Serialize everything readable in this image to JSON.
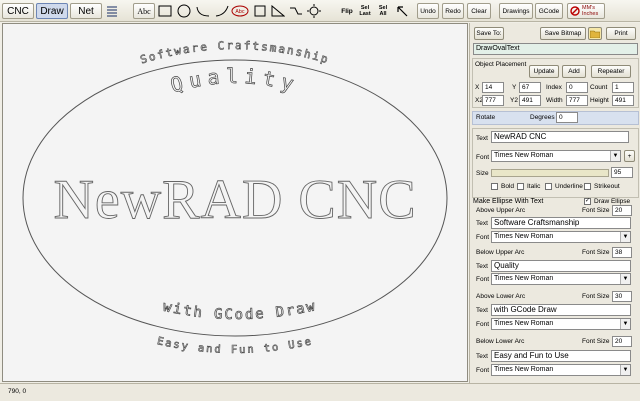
{
  "toolbar": {
    "tabs": [
      "CNC",
      "Draw",
      "Net"
    ],
    "text_tool": "Abc",
    "flip_label": "Flip",
    "sel_last_label": "Sel Last",
    "sel_all_label": "Sel All",
    "undo_label": "Undo",
    "redo_label": "Redo",
    "clear_label": "Clear",
    "drawings_label": "Drawings",
    "gcode_label": "GCode",
    "units_mm": "MM's",
    "units_inches": "Inches"
  },
  "panel": {
    "save_to_label": "Save To:",
    "save_bitmap_label": "Save Bitmap",
    "print_label": "Print",
    "current_object": "DrawOvalText",
    "object_placement": {
      "title": "Object Placement",
      "update_label": "Update",
      "add_label": "Add",
      "repeater_label": "Repeater",
      "x_label": "X",
      "x_value": "14",
      "y_label": "Y",
      "y_value": "67",
      "index_label": "Index",
      "index_value": "0",
      "count_label": "Count",
      "count_value": "1",
      "x2_label": "X2",
      "x2_value": "777",
      "y2_label": "Y2",
      "y2_value": "491",
      "width_label": "Width",
      "width_value": "777",
      "height_label": "Height",
      "height_value": "491"
    },
    "rotate": {
      "label": "Rotate",
      "degrees_label": "Degrees",
      "degrees_value": "0"
    },
    "text_section": {
      "text_label": "Text",
      "text_value": "NewRAD CNC",
      "font_label": "Font",
      "font_value": "Times New Roman",
      "size_label": "Size",
      "size_value": "95",
      "bold_label": "Bold",
      "italic_label": "Italic",
      "underline_label": "Underline",
      "strikeout_label": "Strikeout",
      "plus_label": "+"
    },
    "ellipse": {
      "title": "Make Ellipse With Text",
      "draw_ellipse_label": "Draw Ellipse",
      "font_size_label": "Font Size",
      "text_label": "Text",
      "font_label": "Font",
      "arcs": [
        {
          "heading": "Above Upper Arc",
          "font_size": "20",
          "text": "Software Craftsmanship",
          "font": "Times New Roman"
        },
        {
          "heading": "Below Upper Arc",
          "font_size": "38",
          "text": "Quality",
          "font": "Times New Roman"
        },
        {
          "heading": "Above Lower Arc",
          "font_size": "30",
          "text": "with GCode Draw",
          "font": "Times New Roman"
        },
        {
          "heading": "Below Lower Arc",
          "font_size": "20",
          "text": "Easy and Fun to Use",
          "font": "Times New Roman"
        }
      ]
    }
  },
  "canvas": {
    "center_text": "NewRAD CNC",
    "upper_outer": "Software Craftsmanship",
    "upper_inner": "Quality",
    "lower_inner": "with GCode Draw",
    "lower_outer": "Easy and Fun to Use"
  },
  "status": {
    "coords": "790, 0"
  }
}
